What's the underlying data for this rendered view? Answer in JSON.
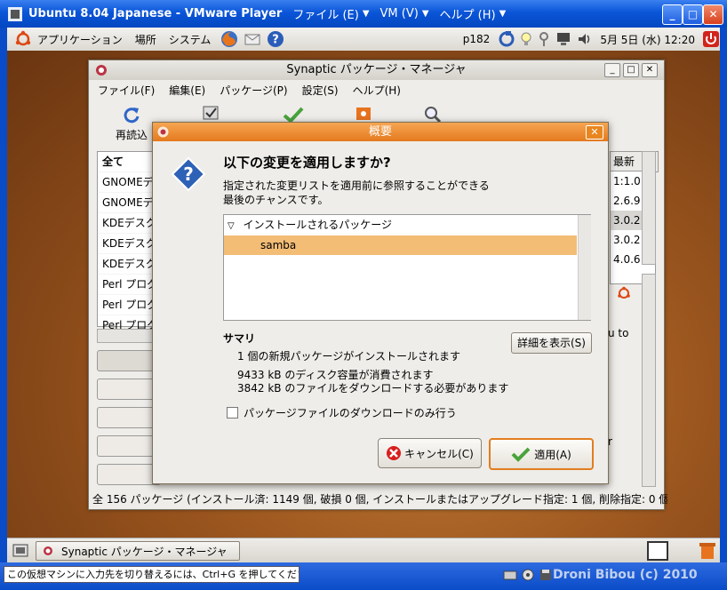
{
  "vmware": {
    "title": "Ubuntu 8.04 Japanese - VMware Player",
    "menus": [
      "ファイル (E)",
      "VM (V)",
      "ヘルプ (H)"
    ],
    "status_text": "この仮想マシンに入力先を切り替えるには、Ctrl+G を押してください。",
    "watermark": "Droni Bibou (c) 2010"
  },
  "top_panel": {
    "menus": [
      "アプリケーション",
      "場所",
      "システム"
    ],
    "host": "p182",
    "datetime": "5月 5日 (水) 12:20"
  },
  "bottom_panel": {
    "task_label": "Synaptic パッケージ・マネージャ"
  },
  "synaptic": {
    "title": "Synaptic パッケージ・マネージャ",
    "menus": [
      "ファイル(F)",
      "編集(E)",
      "パッケージ(P)",
      "設定(S)",
      "ヘルプ(H)"
    ],
    "toolbar_reload": "再読込",
    "left_list": [
      "全て",
      "GNOMEデ",
      "GNOMEデ",
      "KDEデスク",
      "KDEデスク",
      "KDEデスク",
      "Perl プログ",
      "Perl プログ",
      "Perl プログ"
    ],
    "right_header": "最新",
    "right_list": [
      "1:1.0",
      "2.6.9",
      "3.0.2",
      "3.0.2",
      "4.0.6"
    ],
    "right_fragment": "u to",
    "right_fragment2": "r",
    "status": "全 156 パッケージ (インストール済: 1149 個, 破損 0 個, インストールまたはアップグレード指定: 1 個, 削除指定: 0 個"
  },
  "dialog": {
    "title": "概要",
    "heading": "以下の変更を適用しますか?",
    "description": "指定された変更リストを適用前に参照することができる最後のチャンスです。",
    "group_label": "インストールされるパッケージ",
    "package": "samba",
    "summary_title": "サマリ",
    "details_button": "詳細を表示(S)",
    "summary_lines": [
      "1 個の新規パッケージがインストールされます",
      "9433 kB のディスク容量が消費されます",
      "3842 kB のファイルをダウンロードする必要があります"
    ],
    "download_only_label": "パッケージファイルのダウンロードのみ行う",
    "cancel_button": "キャンセル(C)",
    "apply_button": "適用(A)"
  },
  "colors": {
    "accent": "#e47a1e",
    "selection": "#f3bd76",
    "vmware_blue": "#0a55d8"
  }
}
